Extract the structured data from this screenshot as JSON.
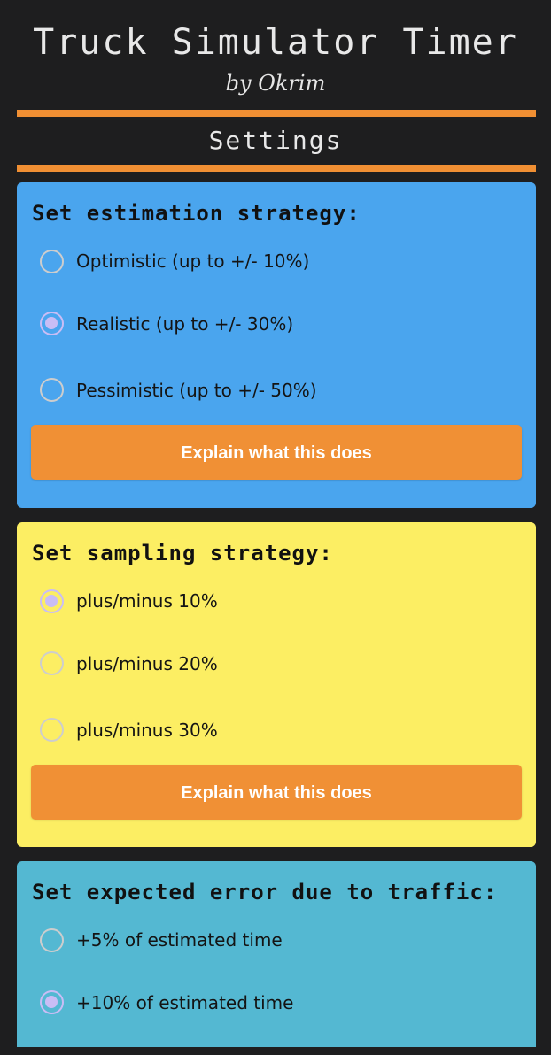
{
  "header": {
    "title": "Truck Simulator Timer",
    "subtitle": "by Okrim"
  },
  "section": {
    "title": "Settings"
  },
  "colors": {
    "background": "#1e1e1f",
    "accent": "#f08f33",
    "card_estimation": "#4aa5ee",
    "card_sampling": "#fcee63",
    "card_traffic": "#54b8d2",
    "radio_checked": "#c9bdf5"
  },
  "cards": {
    "estimation": {
      "title": "Set estimation strategy:",
      "options": [
        {
          "label": "Optimistic (up to +/- 10%)",
          "checked": false
        },
        {
          "label": "Realistic (up to +/- 30%)",
          "checked": true
        },
        {
          "label": "Pessimistic (up to +/- 50%)",
          "checked": false
        }
      ],
      "button_label": "Explain what this does"
    },
    "sampling": {
      "title": "Set sampling strategy:",
      "options": [
        {
          "label": "plus/minus 10%",
          "checked": true
        },
        {
          "label": "plus/minus 20%",
          "checked": false
        },
        {
          "label": "plus/minus 30%",
          "checked": false
        }
      ],
      "button_label": "Explain what this does"
    },
    "traffic": {
      "title": "Set expected error due to traffic:",
      "options": [
        {
          "label": "+5% of estimated time",
          "checked": false
        },
        {
          "label": "+10% of estimated time",
          "checked": true
        }
      ]
    }
  }
}
